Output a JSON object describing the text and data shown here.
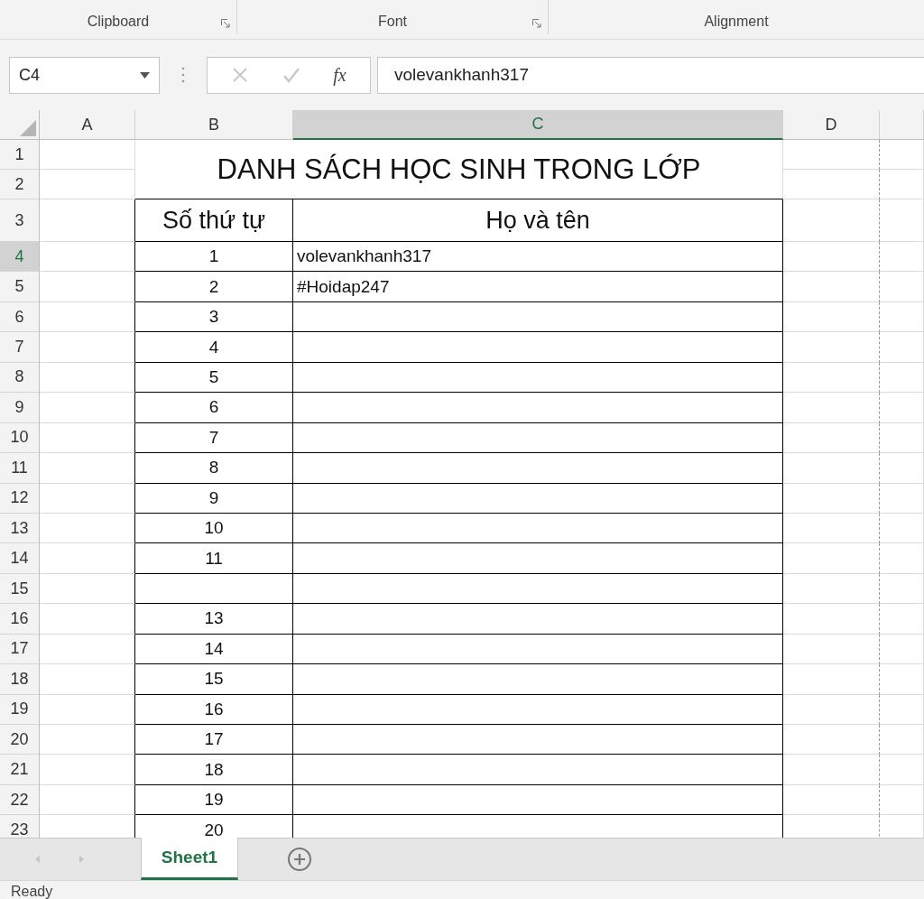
{
  "ribbon": {
    "groups": [
      {
        "label": "Clipboard",
        "launcher": true
      },
      {
        "label": "Font",
        "launcher": true
      },
      {
        "label": "Alignment",
        "launcher": false
      }
    ]
  },
  "formula_bar": {
    "name_box": "C4",
    "function_label": "fx",
    "value": "volevankhanh317"
  },
  "column_headers": [
    {
      "label": "A",
      "selected": false
    },
    {
      "label": "B",
      "selected": false
    },
    {
      "label": "C",
      "selected": true
    },
    {
      "label": "D",
      "selected": false
    }
  ],
  "row_headers": [
    {
      "label": "1",
      "selected": false
    },
    {
      "label": "2",
      "selected": false
    },
    {
      "label": "3",
      "selected": false
    },
    {
      "label": "4",
      "selected": true
    },
    {
      "label": "5",
      "selected": false
    },
    {
      "label": "6",
      "selected": false
    },
    {
      "label": "7",
      "selected": false
    },
    {
      "label": "8",
      "selected": false
    },
    {
      "label": "9",
      "selected": false
    },
    {
      "label": "10",
      "selected": false
    },
    {
      "label": "11",
      "selected": false
    },
    {
      "label": "12",
      "selected": false
    },
    {
      "label": "13",
      "selected": false
    },
    {
      "label": "14",
      "selected": false
    },
    {
      "label": "15",
      "selected": false
    },
    {
      "label": "16",
      "selected": false
    },
    {
      "label": "17",
      "selected": false
    },
    {
      "label": "18",
      "selected": false
    },
    {
      "label": "19",
      "selected": false
    },
    {
      "label": "20",
      "selected": false
    },
    {
      "label": "21",
      "selected": false
    },
    {
      "label": "22",
      "selected": false
    },
    {
      "label": "23",
      "selected": false
    }
  ],
  "title": "DANH SÁCH HỌC SINH TRONG LỚP",
  "table": {
    "columns": [
      "Số thứ tự",
      "Họ và tên"
    ],
    "rows": [
      {
        "number": "1",
        "name": "volevankhanh317"
      },
      {
        "number": "2",
        "name": "#Hoidap247"
      },
      {
        "number": "3"
      },
      {
        "number": "4"
      },
      {
        "number": "5"
      },
      {
        "number": "6"
      },
      {
        "number": "7"
      },
      {
        "number": "8"
      },
      {
        "number": "9"
      },
      {
        "number": "10"
      },
      {
        "number": "11"
      },
      {},
      {
        "number": "13"
      },
      {
        "number": "14"
      },
      {
        "number": "15"
      },
      {
        "number": "16"
      },
      {
        "number": "17"
      },
      {
        "number": "18"
      },
      {
        "number": "19"
      },
      {
        "number": "20"
      }
    ]
  },
  "sheet_tabs": [
    {
      "label": "Sheet1",
      "selected": true
    }
  ],
  "status_bar": {
    "text": "Ready"
  }
}
